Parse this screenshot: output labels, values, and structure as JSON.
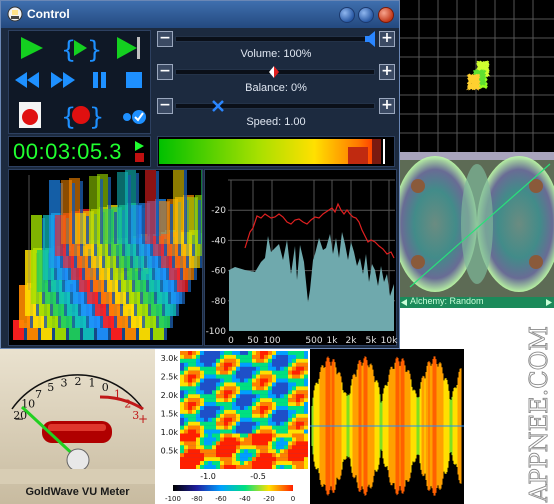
{
  "window": {
    "title": "Control"
  },
  "transport": {
    "buttons": [
      "play",
      "play-selection",
      "play-to-end",
      "rewind",
      "fast-forward",
      "pause",
      "stop",
      "record-new",
      "record-selection",
      "record-options"
    ]
  },
  "sliders": {
    "volume_label": "Volume: 100%",
    "volume_level": 1.0,
    "balance_label": "Balance: 0%",
    "balance_level": 0.5,
    "speed_label": "Speed: 1.00",
    "speed_level": 0.3,
    "minus": "−",
    "plus": "+"
  },
  "time": "00:03:05.3",
  "spectrum_chart": {
    "y_ticks": [
      "-20",
      "-40",
      "-60",
      "-80",
      "-100"
    ],
    "x_ticks": [
      "0",
      "50",
      "100",
      "500",
      "1k",
      "2k",
      "5k",
      "10k"
    ]
  },
  "alchemy": {
    "label": "Alchemy: Random"
  },
  "vu_meter": {
    "scale_top": [
      "20",
      "10",
      "7",
      "5",
      "3",
      "2",
      "1",
      "0",
      "1",
      "2",
      "3"
    ],
    "minus_sign": "−",
    "plus_sign": "+",
    "caption": "GoldWave VU Meter"
  },
  "spectrogram": {
    "y_ticks": [
      "3.0k",
      "2.5k",
      "2.0k",
      "1.5k",
      "1.0k",
      "0.5k"
    ],
    "x_ticks": [
      "-1.0",
      "-0.5"
    ],
    "scale_ticks": [
      "-100",
      "-80",
      "-60",
      "-40",
      "-20",
      "0"
    ]
  },
  "watermark": "APPNEE.COM",
  "colors": {
    "accent": "#1e90ff",
    "green": "#20ff30",
    "red": "#ff2020"
  }
}
